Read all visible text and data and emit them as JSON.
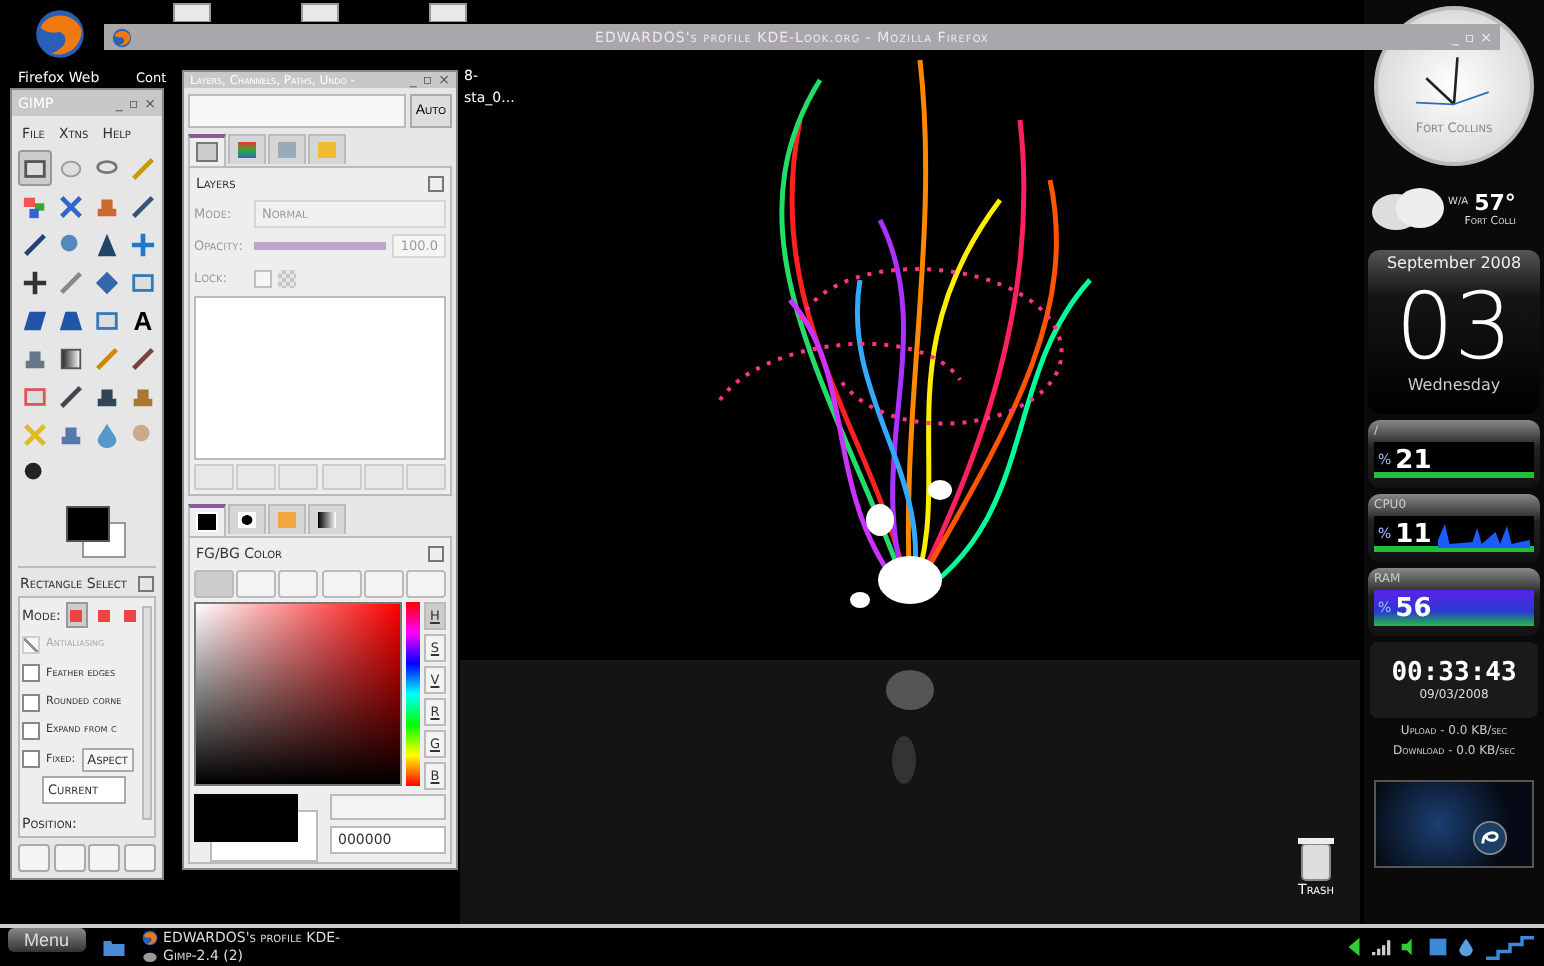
{
  "desktop_icons": [
    {
      "label": "Firefox Web",
      "kind": "firefox"
    },
    {
      "label": "Cont",
      "kind": "file"
    },
    {
      "label": "8-",
      "kind": "file"
    },
    {
      "label": "sta_0...",
      "kind": "file"
    }
  ],
  "browser_window": {
    "title": "EDWARDOS's profile KDE-Look.org - Mozilla Firefox",
    "buttons": [
      "_",
      "▫",
      "×"
    ]
  },
  "toolbox": {
    "title": "GIMP",
    "buttons": [
      "_",
      "▫",
      "×"
    ],
    "menu": [
      "File",
      "Xtns",
      "Help"
    ],
    "tools": [
      {
        "selected": true
      },
      {
        "selected": false
      },
      {
        "selected": false
      },
      {
        "selected": false
      },
      {
        "selected": false
      },
      {
        "selected": false
      },
      {
        "selected": false
      },
      {
        "selected": false
      },
      {
        "selected": false
      },
      {
        "selected": false
      },
      {
        "selected": false
      },
      {
        "selected": false
      },
      {
        "selected": false
      },
      {
        "selected": false
      },
      {
        "selected": false
      },
      {
        "selected": false
      },
      {
        "selected": false
      },
      {
        "selected": false
      },
      {
        "selected": false
      },
      {
        "selected": false,
        "glyph": "A"
      },
      {
        "selected": false
      },
      {
        "selected": false
      },
      {
        "selected": false
      },
      {
        "selected": false
      },
      {
        "selected": false
      },
      {
        "selected": false
      },
      {
        "selected": false
      },
      {
        "selected": false
      },
      {
        "selected": false
      },
      {
        "selected": false
      },
      {
        "selected": false
      },
      {
        "selected": false
      },
      {
        "selected": false
      }
    ],
    "tool_options": {
      "title": "Rectangle Select",
      "mode_label": "Mode:",
      "modes": [
        {
          "selected": true
        },
        {
          "selected": false
        },
        {
          "selected": false
        }
      ],
      "options": [
        {
          "label": "Antialiasing",
          "checked": true,
          "disabled": true
        },
        {
          "label": "Feather edges",
          "checked": false,
          "disabled": false
        },
        {
          "label": "Rounded corne",
          "checked": false,
          "disabled": false
        },
        {
          "label": "Expand from c",
          "checked": false,
          "disabled": false
        },
        {
          "label": "Fixed:",
          "checked": false,
          "disabled": false
        }
      ],
      "fixed_value": "Aspect",
      "current": "Current",
      "position_label": "Position:"
    }
  },
  "dock": {
    "title": "Layers, Channels, Paths, Undo -",
    "buttons": [
      "_",
      "▫",
      "×"
    ],
    "auto": "Auto",
    "tabs": [
      {
        "selected": true
      },
      {
        "selected": false
      },
      {
        "selected": false
      },
      {
        "selected": false
      }
    ],
    "layers": {
      "title": "Layers",
      "disabled": true,
      "mode_label": "Mode:",
      "mode": "Normal",
      "opacity_label": "Opacity:",
      "opacity": "100.0",
      "level": 1.0,
      "lock_label": "Lock:",
      "lock_checked": false
    },
    "color_tabs": [
      {
        "selected": true
      },
      {
        "selected": false
      },
      {
        "selected": false
      },
      {
        "selected": false
      }
    ],
    "color": {
      "title": "FG/BG Color",
      "channels": [
        {
          "label": "H",
          "selected": true
        },
        {
          "label": "S",
          "selected": false
        },
        {
          "label": "V",
          "selected": false
        },
        {
          "label": "R",
          "selected": false
        },
        {
          "label": "G",
          "selected": false
        },
        {
          "label": "B",
          "selected": false
        }
      ],
      "hex": "000000"
    }
  },
  "trash": {
    "label": "Trash"
  },
  "widgets": {
    "clock": {
      "city": "Fort Collins"
    },
    "weather": {
      "note": "W/A",
      "temperature": "57°",
      "city": "Fort Colli"
    },
    "calendar": {
      "month": "September 2008",
      "day": "03",
      "weekday": "Wednesday"
    },
    "meters": [
      {
        "label": "/",
        "unit": "%",
        "value": "21",
        "kind": "bar"
      },
      {
        "label": "CPU0",
        "unit": "%",
        "value": "11",
        "kind": "graph"
      },
      {
        "label": "RAM",
        "unit": "%",
        "value": "56",
        "kind": "rainbow"
      }
    ],
    "timer": {
      "time": "00:33:43",
      "date": "09/03/2008"
    },
    "network": [
      "Upload - 0.0 KB/sec",
      "Download - 0.0 KB/sec"
    ]
  },
  "taskbar": {
    "menu": "Menu",
    "tasks": [
      {
        "label": "EDWARDOS's profile KDE-",
        "kind": "firefox"
      },
      {
        "label": "Gimp-2.4 (2)",
        "kind": "gimp"
      }
    ]
  }
}
